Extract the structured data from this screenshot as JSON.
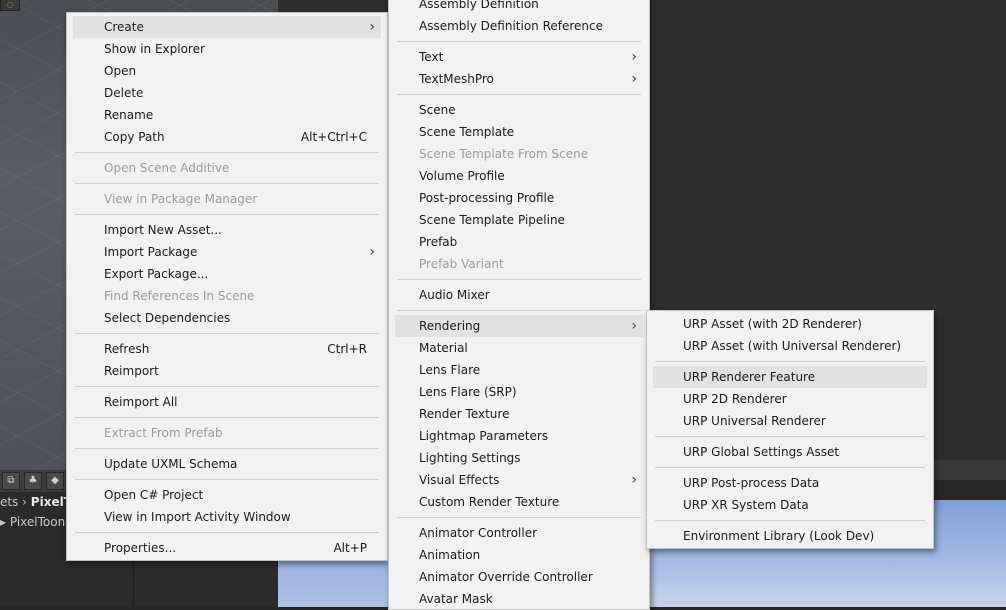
{
  "background": {
    "breadcrumb_prefix": "ets",
    "breadcrumb_current": "PixelT",
    "file_label": "PixelToonS"
  },
  "main_menu": {
    "items": [
      {
        "label": "Create",
        "shortcut": "",
        "submenu": true,
        "disabled": false,
        "highlight": true
      },
      {
        "label": "Show in Explorer",
        "shortcut": "",
        "submenu": false,
        "disabled": false
      },
      {
        "label": "Open",
        "shortcut": "",
        "submenu": false,
        "disabled": false
      },
      {
        "label": "Delete",
        "shortcut": "",
        "submenu": false,
        "disabled": false
      },
      {
        "label": "Rename",
        "shortcut": "",
        "submenu": false,
        "disabled": false
      },
      {
        "label": "Copy Path",
        "shortcut": "Alt+Ctrl+C",
        "submenu": false,
        "disabled": false,
        "sep_after": true
      },
      {
        "label": "Open Scene Additive",
        "shortcut": "",
        "submenu": false,
        "disabled": true,
        "sep_after": true
      },
      {
        "label": "View in Package Manager",
        "shortcut": "",
        "submenu": false,
        "disabled": true,
        "sep_after": true
      },
      {
        "label": "Import New Asset...",
        "shortcut": "",
        "submenu": false,
        "disabled": false
      },
      {
        "label": "Import Package",
        "shortcut": "",
        "submenu": true,
        "disabled": false
      },
      {
        "label": "Export Package...",
        "shortcut": "",
        "submenu": false,
        "disabled": false
      },
      {
        "label": "Find References In Scene",
        "shortcut": "",
        "submenu": false,
        "disabled": true
      },
      {
        "label": "Select Dependencies",
        "shortcut": "",
        "submenu": false,
        "disabled": false,
        "sep_after": true
      },
      {
        "label": "Refresh",
        "shortcut": "Ctrl+R",
        "submenu": false,
        "disabled": false
      },
      {
        "label": "Reimport",
        "shortcut": "",
        "submenu": false,
        "disabled": false,
        "sep_after": true
      },
      {
        "label": "Reimport All",
        "shortcut": "",
        "submenu": false,
        "disabled": false,
        "sep_after": true
      },
      {
        "label": "Extract From Prefab",
        "shortcut": "",
        "submenu": false,
        "disabled": true,
        "sep_after": true
      },
      {
        "label": "Update UXML Schema",
        "shortcut": "",
        "submenu": false,
        "disabled": false,
        "sep_after": true
      },
      {
        "label": "Open C# Project",
        "shortcut": "",
        "submenu": false,
        "disabled": false
      },
      {
        "label": "View in Import Activity Window",
        "shortcut": "",
        "submenu": false,
        "disabled": false,
        "sep_after": true
      },
      {
        "label": "Properties...",
        "shortcut": "Alt+P",
        "submenu": false,
        "disabled": false
      }
    ]
  },
  "create_submenu": {
    "items": [
      {
        "label": "Assembly Definition",
        "submenu": false,
        "disabled": false
      },
      {
        "label": "Assembly Definition Reference",
        "submenu": false,
        "disabled": false,
        "sep_after": true
      },
      {
        "label": "Text",
        "submenu": true,
        "disabled": false
      },
      {
        "label": "TextMeshPro",
        "submenu": true,
        "disabled": false,
        "sep_after": true
      },
      {
        "label": "Scene",
        "submenu": false,
        "disabled": false
      },
      {
        "label": "Scene Template",
        "submenu": false,
        "disabled": false
      },
      {
        "label": "Scene Template From Scene",
        "submenu": false,
        "disabled": true
      },
      {
        "label": "Volume Profile",
        "submenu": false,
        "disabled": false
      },
      {
        "label": "Post-processing Profile",
        "submenu": false,
        "disabled": false
      },
      {
        "label": "Scene Template Pipeline",
        "submenu": false,
        "disabled": false
      },
      {
        "label": "Prefab",
        "submenu": false,
        "disabled": false
      },
      {
        "label": "Prefab Variant",
        "submenu": false,
        "disabled": true,
        "sep_after": true
      },
      {
        "label": "Audio Mixer",
        "submenu": false,
        "disabled": false,
        "sep_after": true
      },
      {
        "label": "Rendering",
        "submenu": true,
        "disabled": false,
        "highlight": true
      },
      {
        "label": "Material",
        "submenu": false,
        "disabled": false
      },
      {
        "label": "Lens Flare",
        "submenu": false,
        "disabled": false
      },
      {
        "label": "Lens Flare (SRP)",
        "submenu": false,
        "disabled": false
      },
      {
        "label": "Render Texture",
        "submenu": false,
        "disabled": false
      },
      {
        "label": "Lightmap Parameters",
        "submenu": false,
        "disabled": false
      },
      {
        "label": "Lighting Settings",
        "submenu": false,
        "disabled": false
      },
      {
        "label": "Visual Effects",
        "submenu": true,
        "disabled": false
      },
      {
        "label": "Custom Render Texture",
        "submenu": false,
        "disabled": false,
        "sep_after": true
      },
      {
        "label": "Animator Controller",
        "submenu": false,
        "disabled": false
      },
      {
        "label": "Animation",
        "submenu": false,
        "disabled": false
      },
      {
        "label": "Animator Override Controller",
        "submenu": false,
        "disabled": false
      },
      {
        "label": "Avatar Mask",
        "submenu": false,
        "disabled": false
      }
    ]
  },
  "rendering_submenu": {
    "items": [
      {
        "label": "URP Asset (with 2D Renderer)",
        "disabled": false
      },
      {
        "label": "URP Asset (with Universal Renderer)",
        "disabled": false,
        "sep_after": true
      },
      {
        "label": "URP Renderer Feature",
        "disabled": false,
        "highlight": true
      },
      {
        "label": "URP 2D Renderer",
        "disabled": false
      },
      {
        "label": "URP Universal Renderer",
        "disabled": false,
        "sep_after": true
      },
      {
        "label": "URP Global Settings Asset",
        "disabled": false,
        "sep_after": true
      },
      {
        "label": "URP Post-process Data",
        "disabled": false
      },
      {
        "label": "URP XR System Data",
        "disabled": false,
        "sep_after": true
      },
      {
        "label": "Environment Library (Look Dev)",
        "disabled": false
      }
    ]
  }
}
